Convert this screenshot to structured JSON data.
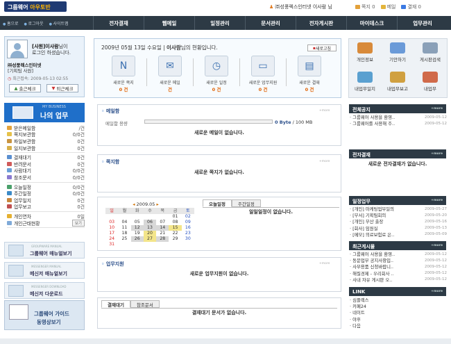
{
  "header": {
    "logo_main": "그룹웨어",
    "logo_accent": "아우토반",
    "user_info": "㈜성풍렉스인터넷 이사람 님",
    "links": [
      {
        "label": "쪽지 0",
        "icon": "note-icon",
        "color": "#e3a13b"
      },
      {
        "label": "메일",
        "icon": "mail-icon",
        "color": "#e3b43b"
      },
      {
        "label": "결재 0",
        "icon": "approval-icon",
        "color": "#3b7ae3"
      }
    ]
  },
  "nav": {
    "left_links": [
      "홈으로",
      "로그아웃",
      "사이트맵"
    ],
    "tabs": [
      "전자결재",
      "웹메일",
      "일정관리",
      "문서관리",
      "전자게시판",
      "마이데스크",
      "업무관리"
    ]
  },
  "profile": {
    "name_line1": "[사원]이사람",
    "name_line1_suffix": "님이",
    "name_line2": "로그인 하셨습니다.",
    "company": "㈜성풍렉스인터넷",
    "dept": "[기획팀 사원]",
    "login_time": "최근접속: 2009-05-13 02:55",
    "btn_in": "출근체크",
    "btn_out": "퇴근체크"
  },
  "mywork": {
    "small": "MY BUSINESS",
    "title": "나의 업무"
  },
  "worklist": [
    [
      {
        "label": "받은메일함",
        "value": "/건",
        "color": "#e4a33c"
      },
      {
        "label": "쪽지보관함",
        "value": "0/0건",
        "color": "#e6c24a"
      },
      {
        "label": "파일보관함",
        "value": "0건",
        "color": "#c99440"
      },
      {
        "label": "일지보관함",
        "value": "0건",
        "color": "#d7b04a"
      }
    ],
    [
      {
        "label": "결재대기",
        "value": "0건",
        "color": "#5a8fd0"
      },
      {
        "label": "반려문서",
        "value": "0건",
        "color": "#d05a5a"
      },
      {
        "label": "사람대기",
        "value": "0/0건",
        "color": "#6aa0d8"
      },
      {
        "label": "참조문서",
        "value": "0/0건",
        "color": "#8a7ad0"
      }
    ],
    [
      {
        "label": "오늘일정",
        "value": "0/0건",
        "color": "#4aa06a"
      },
      {
        "label": "주간일정",
        "value": "0/0건",
        "color": "#3b8ac7"
      },
      {
        "label": "업무일지",
        "value": "0건",
        "color": "#c8863b"
      },
      {
        "label": "업무보고",
        "value": "0건",
        "color": "#c05050"
      }
    ],
    [
      {
        "label": "개인연차",
        "value": "0일",
        "color": "#e5b030"
      },
      {
        "label": "개인근태현황",
        "value": "보기",
        "color": "#7faad8",
        "button": true
      }
    ]
  ],
  "banners": [
    {
      "small": "GROUPWARE MANUAL",
      "title": "그룹웨어 매뉴얼보기"
    },
    {
      "small": "MESSENGER MANUAL",
      "title": "메신저 매뉴얼보기"
    },
    {
      "small": "MESSENGER DOWNLOAD",
      "title": "메신저 다운로드"
    }
  ],
  "guide": {
    "line1": "그룹웨어 가이드",
    "line2": "동영상보기"
  },
  "newsummary": {
    "date_prefix": "2009년 05월 13일 수요일 |",
    "user": "이사람",
    "date_suffix": "님의 현황입니다.",
    "refresh": "새로고침",
    "items": [
      {
        "label": "새로운 쪽지",
        "count": "0 건",
        "icon": "note-icon",
        "glyph": "N"
      },
      {
        "label": "새로운 메일",
        "count": "건",
        "icon": "envelope-icon",
        "glyph": "✉"
      },
      {
        "label": "새로운 일정",
        "count": "0 건",
        "icon": "alarm-clock-icon",
        "glyph": "◷"
      },
      {
        "label": "새로운 업무지원",
        "count": "0 건",
        "icon": "laptop-icon",
        "glyph": "▭"
      },
      {
        "label": "새로운 결재",
        "count": "0 건",
        "icon": "folder-icon",
        "glyph": "▤"
      }
    ]
  },
  "mail": {
    "title": "메일함",
    "more": "+more",
    "usage_label": "메일함 용량",
    "usage_value": "0 Byte",
    "usage_total": "/ 100 MB",
    "empty": "새로운 메일이 없습니다."
  },
  "memo": {
    "title": "쪽지함",
    "more": "+more",
    "empty": "새로운 쪽지가 없습니다."
  },
  "calendar": {
    "month": "2009.05",
    "weekdays": [
      "일",
      "월",
      "화",
      "수",
      "목",
      "금",
      "토"
    ],
    "days": [
      [
        "",
        "",
        "",
        "",
        "",
        "01",
        "02"
      ],
      [
        "03",
        "04",
        "05",
        "06",
        "07",
        "08",
        "09"
      ],
      [
        "10",
        "11",
        "12",
        "13",
        "14",
        "15",
        "16"
      ],
      [
        "17",
        "18",
        "19",
        "20",
        "21",
        "22",
        "23"
      ],
      [
        "24",
        "25",
        "26",
        "27",
        "28",
        "29",
        "30"
      ],
      [
        "31",
        "",
        "",
        "",
        "",
        "",
        ""
      ]
    ]
  },
  "schedule": {
    "tab_today": "오늘일정",
    "tab_week": "주간일정",
    "empty": "일일일정이 없습니다."
  },
  "support": {
    "title": "업무지원",
    "more": "+more",
    "empty": "새로운 업무지원이 없습니다."
  },
  "approval_tabs": {
    "tab1": "결재대기",
    "tab2": "참조문서",
    "empty": "결재대기 문서가 없습니다."
  },
  "quick": [
    {
      "label": "개인정보",
      "color": "#d88a3a"
    },
    {
      "label": "기안하기",
      "color": "#6a9ad8"
    },
    {
      "label": "게시판검색",
      "color": "#8aa0b8"
    },
    {
      "label": "내업무일지",
      "color": "#5aa0d0"
    },
    {
      "label": "내업무보고",
      "color": "#d0a040"
    },
    {
      "label": "내업무",
      "color": "#d06a4a"
    }
  ],
  "notice": {
    "title": "전체공지",
    "more": "+more",
    "rows": [
      {
        "t": "그룹웨어 사용을 환영..",
        "d": "2009-05-12"
      },
      {
        "t": "그룹웨어를 사용해 주..",
        "d": "2009-05-12"
      }
    ]
  },
  "eapproval": {
    "title": "전자결재",
    "more": "+more",
    "empty": "새로운 전자결재가 없습니다."
  },
  "tasks": {
    "title": "일정업무",
    "more": "+more",
    "rows": [
      {
        "t": "[개인] 마케팅업무일의",
        "d": "2009-05-27"
      },
      {
        "t": "[부서] 기획팀회의",
        "d": "2009-05-20"
      },
      {
        "t": "[개인] 부산 출장",
        "d": "2009-05-16"
      },
      {
        "t": "[회사] 임원실",
        "d": "2009-05-13"
      },
      {
        "t": "[메모] 의료보험료 은..",
        "d": "2009-05-09"
      }
    ]
  },
  "board": {
    "title": "최근게시물",
    "more": "+more",
    "rows": [
      {
        "t": "그룹웨어 사용을 환영..",
        "d": "2009-05-12"
      },
      {
        "t": "동문업무 공지사항입..",
        "d": "2009-05-12"
      },
      {
        "t": "사무용품 신청바랍니..",
        "d": "2009-05-12"
      },
      {
        "t": "해질경제 - 우리회사 ..",
        "d": "2009-05-12"
      },
      {
        "t": "사내 자유 게시판 오..",
        "d": "2009-05-12"
      }
    ]
  },
  "link": {
    "title": "LINK",
    "more": "+more",
    "rows": [
      "심플렉스",
      "카페24",
      "네이트",
      "야후",
      "다음"
    ]
  }
}
